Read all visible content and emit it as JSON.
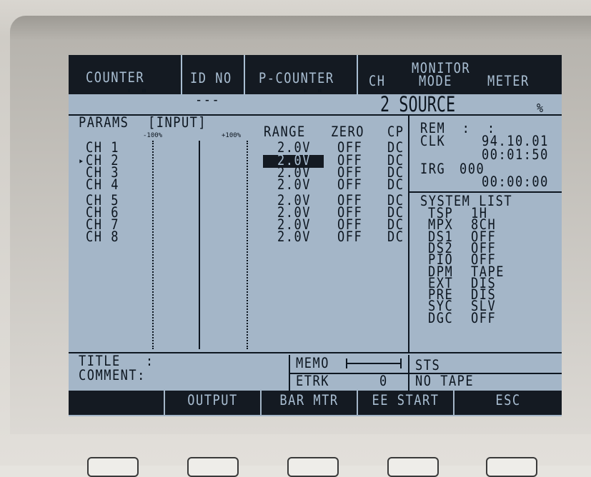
{
  "header": {
    "counter_label": "COUNTER",
    "counter_value": "' \"",
    "id_label": "ID NO",
    "id_value": "---",
    "pcounter_label": "P-COUNTER",
    "pcounter_value": "' \"",
    "monitor_label": "MONITOR",
    "ch_label": "CH",
    "mode_label": "MODE",
    "meter_label": "METER",
    "source_value": "2 SOURCE",
    "percent": "%"
  },
  "params": {
    "title": "PARAMS",
    "input": "[INPUT]",
    "scale_min": "-100%",
    "scale_max": "+100%",
    "col_range": "RANGE",
    "col_zero": "ZERO",
    "col_cp": "CP",
    "cursor": "▸",
    "channels": [
      {
        "name": "CH 1",
        "range": "2.0V",
        "zero": "OFF",
        "cp": "DC"
      },
      {
        "name": "CH 2",
        "range": "2.0V",
        "zero": "OFF",
        "cp": "DC"
      },
      {
        "name": "CH 3",
        "range": "2.0V",
        "zero": "OFF",
        "cp": "DC"
      },
      {
        "name": "CH 4",
        "range": "2.0V",
        "zero": "OFF",
        "cp": "DC"
      },
      {
        "name": "CH 5",
        "range": "2.0V",
        "zero": "OFF",
        "cp": "DC"
      },
      {
        "name": "CH 6",
        "range": "2.0V",
        "zero": "OFF",
        "cp": "DC"
      },
      {
        "name": "CH 7",
        "range": "2.0V",
        "zero": "OFF",
        "cp": "DC"
      },
      {
        "name": "CH 8",
        "range": "2.0V",
        "zero": "OFF",
        "cp": "DC"
      }
    ]
  },
  "status": {
    "rem": "REM  :  :",
    "clk_label": "CLK",
    "clk_date": "94.10.01",
    "clk_time": "00:01:50",
    "irg_label": "IRG",
    "irg_value": "000",
    "irg_time": "00:00:00"
  },
  "system_list": {
    "title": "SYSTEM LIST",
    "items": [
      {
        "key": "TSP",
        "value": "1H"
      },
      {
        "key": "MPX",
        "value": "8CH"
      },
      {
        "key": "DS1",
        "value": "OFF"
      },
      {
        "key": "DS2",
        "value": "OFF"
      },
      {
        "key": "PIO",
        "value": "OFF"
      },
      {
        "key": "DPM",
        "value": "TAPE"
      },
      {
        "key": "EXT",
        "value": "DIS"
      },
      {
        "key": "PRE",
        "value": "DIS"
      },
      {
        "key": "SYC",
        "value": "SLV"
      },
      {
        "key": "DGC",
        "value": "OFF"
      }
    ]
  },
  "footer": {
    "title_label": "TITLE   :",
    "comment_label": "COMMENT:",
    "memo_label": "MEMO",
    "etrk_label": "ETRK",
    "etrk_value": "0",
    "sts_label": "STS",
    "sts_value": "NO TAPE"
  },
  "softkeys": [
    "",
    "OUTPUT",
    "BAR MTR",
    "EE START",
    "ESC"
  ]
}
